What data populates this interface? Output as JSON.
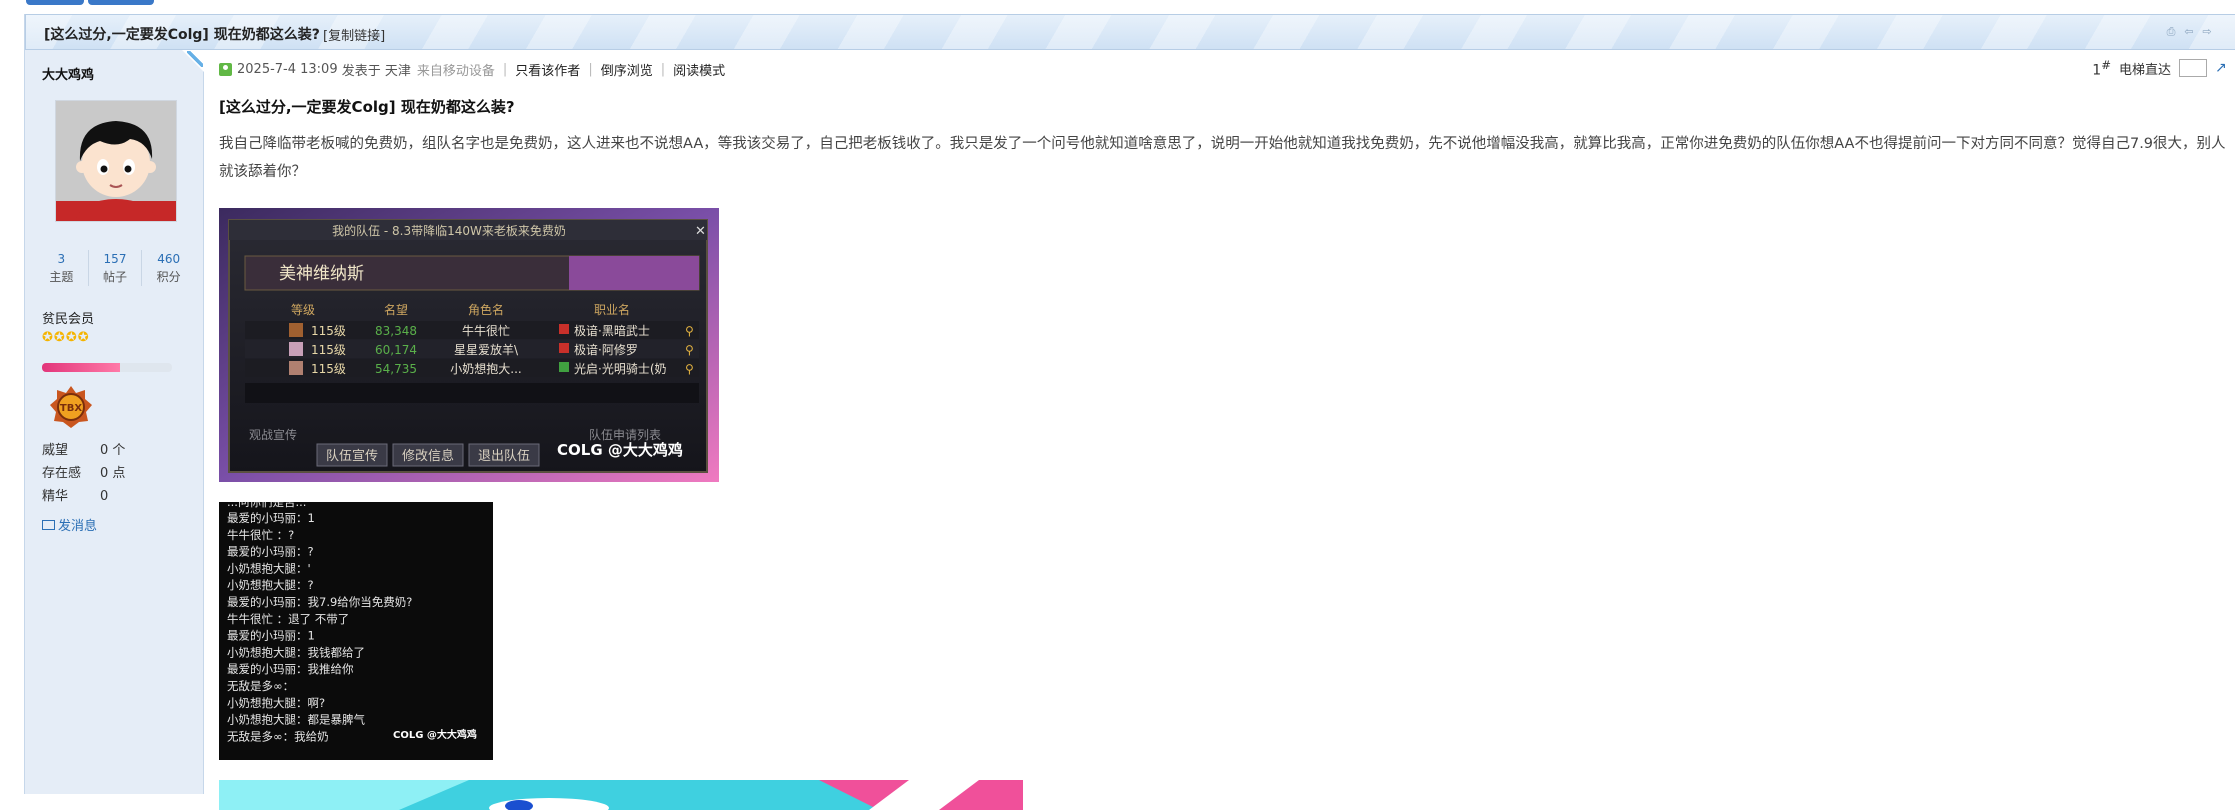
{
  "title_bar": {
    "title": "[这么过分,一定要发Colg] 现在奶都这么装?",
    "copy_link": "[复制链接]"
  },
  "author": {
    "name": "大大鸡鸡",
    "stats": [
      {
        "value": "3",
        "label": "主题"
      },
      {
        "value": "157",
        "label": "帖子"
      },
      {
        "value": "460",
        "label": "积分"
      }
    ],
    "group": "贫民会员",
    "star_count": 4,
    "progress_percent": 60,
    "medal_text": "TBX",
    "info": [
      {
        "key": "威望",
        "value": "0 个"
      },
      {
        "key": "存在感",
        "value": "0 点"
      },
      {
        "key": "精华",
        "value": "0"
      }
    ],
    "send_message": "发消息"
  },
  "post": {
    "timestamp": "2025-7-4 13:09",
    "posted_in": "发表于 天津",
    "device": "来自移动设备",
    "links": [
      "只看该作者",
      "倒序浏览",
      "阅读模式"
    ],
    "floor": "1",
    "floor_suffix": "#",
    "elevator_label": "电梯直达",
    "title": "[这么过分,一定要发Colg] 现在奶都这么装?",
    "body": "我自己降临带老板喊的免费奶，组队名字也是免费奶，这人进来也不说想AA，等我该交易了，自己把老板钱收了。我只是发了一个问号他就知道啥意思了，说明一开始他就知道我找免费奶，先不说他增幅没我高，就算比我高，正常你进免费奶的队伍你想AA不也得提前问一下对方同不同意？觉得自己7.9很大，别人就该舔着你？"
  },
  "screenshot1": {
    "window_title": "我的队伍 - 8.3带降临140W来老板来免费奶",
    "party_name": "美神维纳斯",
    "headers": [
      "等级",
      "名望",
      "角色名",
      "职业名"
    ],
    "rows": [
      {
        "level": "115级",
        "fame": "83,348",
        "name": "牛牛很忙",
        "job": "极谙·黑暗武士"
      },
      {
        "level": "115级",
        "fame": "60,174",
        "name": "星星爱放羊\\",
        "job": "极谙·阿修罗"
      },
      {
        "level": "115级",
        "fame": "54,735",
        "name": "小奶想抱大...",
        "job": "光启·光明骑士(奶"
      }
    ],
    "btn_promote": "队伍宣传",
    "btn_edit": "修改信息",
    "btn_leave": "退出队伍",
    "spectate": "观战宣传",
    "apply_list": "队伍申请列表",
    "watermark": "COLG @大大鸡鸡"
  },
  "screenshot2": {
    "lines": [
      "最爱的小玛丽：1",
      " 牛牛很忙 ：?",
      "最爱的小玛丽：?",
      "小奶想抱大腿：'",
      "小奶想抱大腿：?",
      "最爱的小玛丽：我7.9给你当免费奶?",
      " 牛牛很忙 ：退了 不带了",
      "最爱的小玛丽：1",
      "小奶想抱大腿：我钱都给了",
      "最爱的小玛丽：我推给你",
      "无敌是多∞：",
      "小奶想抱大腿：啊?",
      "小奶想抱大腿：都是暴脾气",
      "无敌是多∞：我给奶"
    ],
    "top_cut": "...问你们是否...",
    "watermark": "COLG @大大鸡鸡"
  },
  "colors": {
    "title_bar": "#d7e6f5",
    "sidebar": "#e5edf7",
    "link_blue": "#2b6fb5",
    "star": "#f5b400",
    "progress": "#e2357a"
  }
}
